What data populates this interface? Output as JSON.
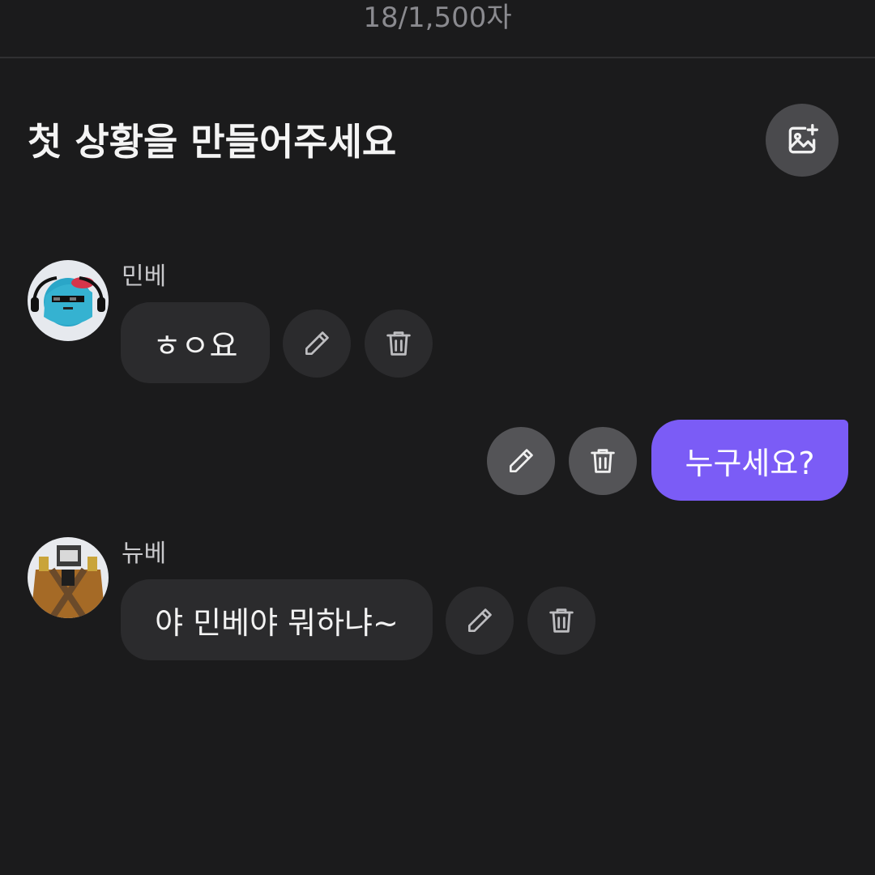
{
  "counter": "18/1,500자",
  "title": "첫 상황을 만들어주세요",
  "add_image_icon": "image-plus-icon",
  "messages": [
    {
      "sender": "민베",
      "text": "ㅎㅇ요",
      "side": "left"
    },
    {
      "sender": "",
      "text": "누구세요?",
      "side": "right"
    },
    {
      "sender": "뉴베",
      "text": "야 민베야 뭐하냐~",
      "side": "left"
    }
  ],
  "icons": {
    "edit": "pencil-icon",
    "delete": "trash-icon"
  },
  "colors": {
    "background": "#1b1b1c",
    "my_bubble": "#7b5cf6",
    "bubble": "#2b2b2d"
  }
}
